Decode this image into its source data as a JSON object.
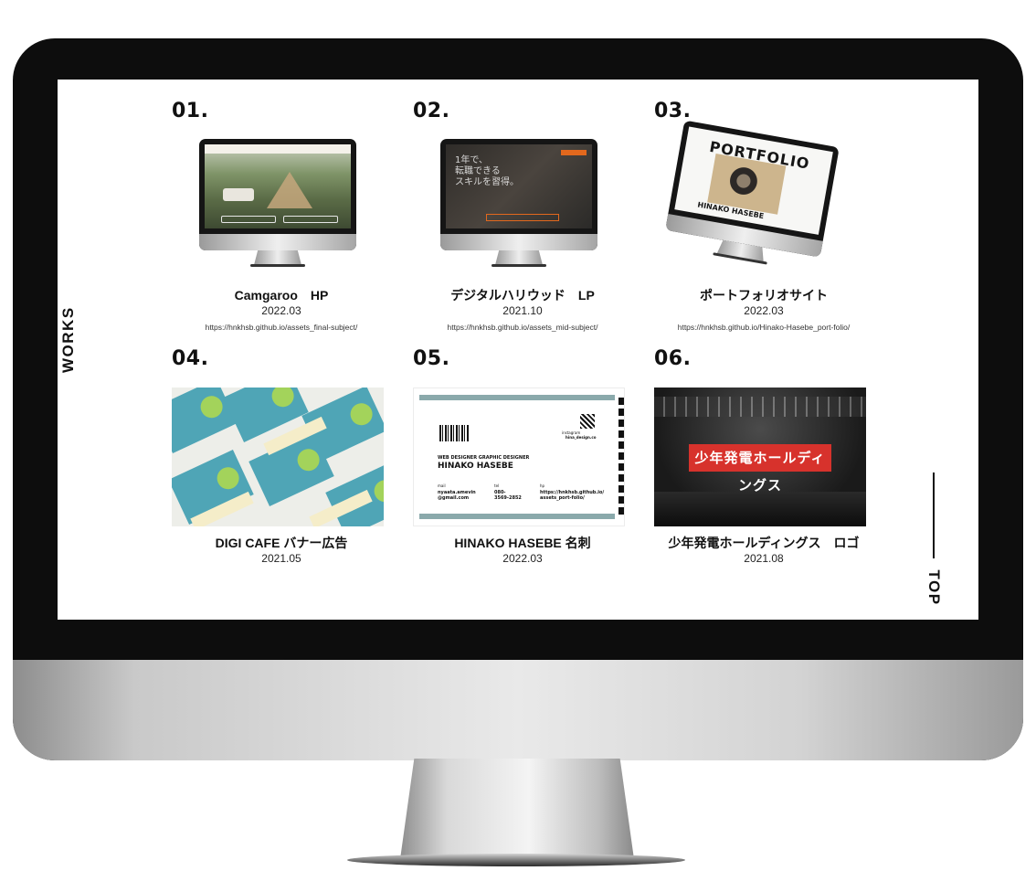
{
  "side": {
    "works_label": "WORKS",
    "top_label": "TOP"
  },
  "works": [
    {
      "num": "01.",
      "title": "Camgaroo　HP",
      "date": "2022.03",
      "url": "https://hnkhsb.github.io/assets_final-subject/"
    },
    {
      "num": "02.",
      "title": "デジタルハリウッド　LP",
      "date": "2021.10",
      "url": "https://hnkhsb.github.io/assets_mid-subject/",
      "screen_text": "1年で、\n転職できる\nスキルを習得。"
    },
    {
      "num": "03.",
      "title": "ポートフォリオサイト",
      "date": "2022.03",
      "url": "https://hnkhsb.github.io/Hinako-Hasebe_port-folio/",
      "screen_heading": "PORTFOLIO",
      "screen_name": "HINAKO HASEBE"
    },
    {
      "num": "04.",
      "title": "DIGI CAFE バナー広告",
      "date": "2021.05"
    },
    {
      "num": "05.",
      "title": "HINAKO HASEBE 名刺",
      "date": "2022.03",
      "card": {
        "roles": "WEB DESIGNER  GRAPHIC DESIGNER",
        "name": "HINAKO HASEBE",
        "mail_label": "mail",
        "mail": "nyaata.amevin\n@gmail.com",
        "tel_label": "tel",
        "tel": "080-\n3569-2852",
        "hp_label": "hp",
        "hp": "https://hnkhsb.github.io/\nassets_port-folio/",
        "insta_label": "instagram",
        "insta": "hina_design.co"
      }
    },
    {
      "num": "06.",
      "title": "少年発電ホールディングス　ロゴ",
      "date": "2021.08",
      "logo_text": "少年発電ホールディングス"
    }
  ],
  "colors": {
    "text": "#111111",
    "screen_bg": "#ffffff",
    "banner_teal": "#4fa5b6",
    "logo_red": "#d7322c"
  }
}
